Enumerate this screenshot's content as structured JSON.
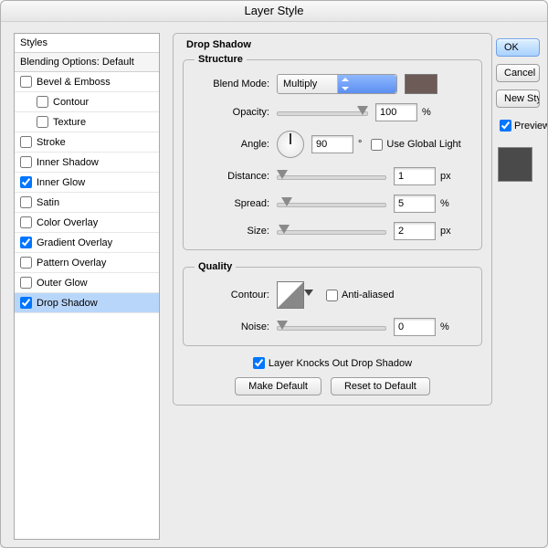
{
  "window": {
    "title": "Layer Style"
  },
  "sidebar": {
    "header": "Styles",
    "blending": "Blending Options: Default",
    "items": [
      {
        "label": "Bevel & Emboss",
        "checked": false,
        "indent": false
      },
      {
        "label": "Contour",
        "checked": false,
        "indent": true
      },
      {
        "label": "Texture",
        "checked": false,
        "indent": true
      },
      {
        "label": "Stroke",
        "checked": false,
        "indent": false
      },
      {
        "label": "Inner Shadow",
        "checked": false,
        "indent": false
      },
      {
        "label": "Inner Glow",
        "checked": true,
        "indent": false
      },
      {
        "label": "Satin",
        "checked": false,
        "indent": false
      },
      {
        "label": "Color Overlay",
        "checked": false,
        "indent": false
      },
      {
        "label": "Gradient Overlay",
        "checked": true,
        "indent": false
      },
      {
        "label": "Pattern Overlay",
        "checked": false,
        "indent": false
      },
      {
        "label": "Outer Glow",
        "checked": false,
        "indent": false
      },
      {
        "label": "Drop Shadow",
        "checked": true,
        "indent": false,
        "selected": true
      }
    ]
  },
  "panel": {
    "title": "Drop Shadow",
    "structure": {
      "legend": "Structure",
      "blend_mode_label": "Blend Mode:",
      "blend_mode_value": "Multiply",
      "opacity_label": "Opacity:",
      "opacity_value": "100",
      "opacity_unit": "%",
      "angle_label": "Angle:",
      "angle_value": "90",
      "angle_unit": "°",
      "global_light_label": "Use Global Light",
      "global_light_checked": false,
      "distance_label": "Distance:",
      "distance_value": "1",
      "distance_unit": "px",
      "spread_label": "Spread:",
      "spread_value": "5",
      "spread_unit": "%",
      "size_label": "Size:",
      "size_value": "2",
      "size_unit": "px",
      "shadow_color": "#6c5b57"
    },
    "quality": {
      "legend": "Quality",
      "contour_label": "Contour:",
      "anti_aliased_label": "Anti-aliased",
      "anti_aliased_checked": false,
      "noise_label": "Noise:",
      "noise_value": "0",
      "noise_unit": "%"
    },
    "knockout_label": "Layer Knocks Out Drop Shadow",
    "knockout_checked": true,
    "make_default": "Make Default",
    "reset_default": "Reset to Default"
  },
  "buttons": {
    "ok": "OK",
    "cancel": "Cancel",
    "new_style": "New Style...",
    "preview_label": "Preview",
    "preview_checked": true
  }
}
